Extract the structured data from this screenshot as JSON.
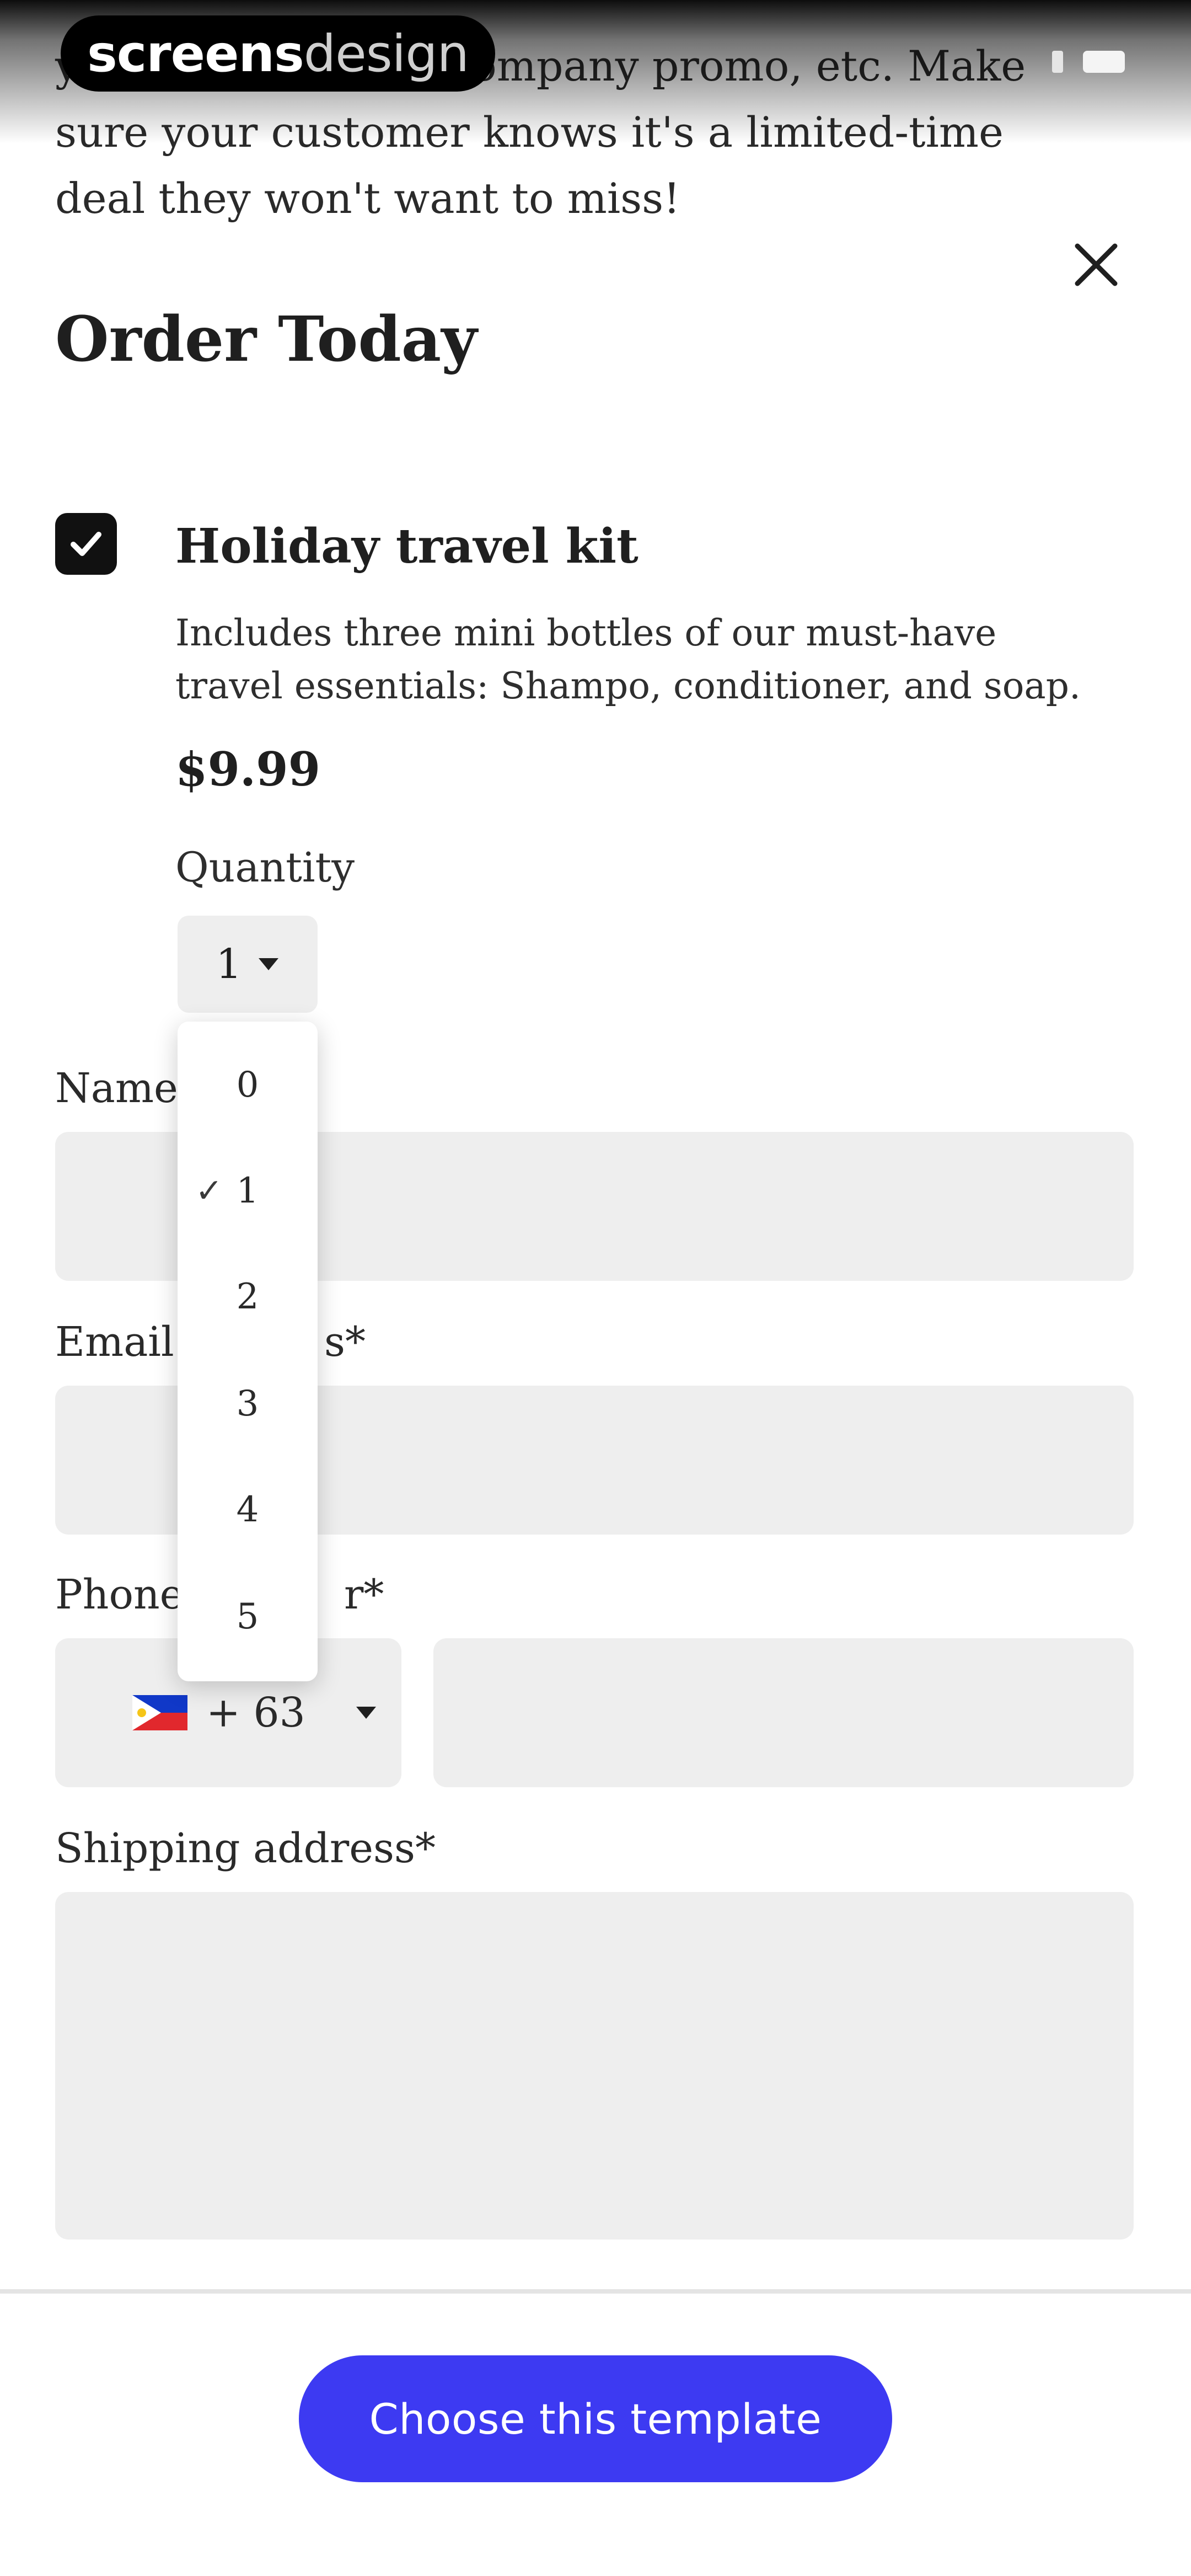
{
  "brand": {
    "logo_light": "screens",
    "logo_bold": "design"
  },
  "intro_text": "your special offer, company promo, etc. Make sure your customer knows it's a limited-time deal they won't want to miss!",
  "form": {
    "title": "Order Today",
    "product": {
      "checked": true,
      "name": "Holiday travel kit",
      "description": "Includes three mini bottles of our must-have travel essentials: Shampo, conditioner, and soap.",
      "price": "$9.99",
      "quantity_label": "Quantity",
      "quantity_selected": "1",
      "quantity_options": [
        "0",
        "1",
        "2",
        "3",
        "4",
        "5"
      ]
    },
    "fields": {
      "name_label": "Name",
      "email_label": "Email",
      "email_suffix": "s*",
      "phone_label": "Phone",
      "phone_suffix": "r*",
      "phone_country_code": "+ 63",
      "shipping_label": "Shipping address*"
    }
  },
  "cta": {
    "label": "Choose this template"
  },
  "colors": {
    "accent": "#3d3af2",
    "field_bg": "#eeeeee",
    "text": "#1f1f1f"
  },
  "icons": {
    "close": "close-icon",
    "checkbox": "checkmark-icon",
    "caret": "caret-down-icon",
    "flag": "philippines-flag-icon"
  }
}
